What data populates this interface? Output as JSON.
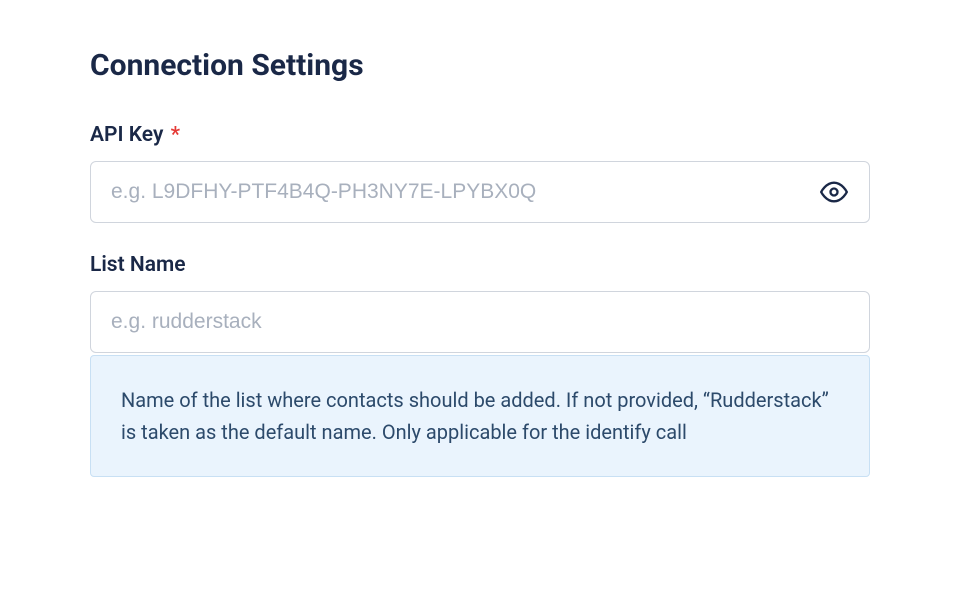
{
  "page": {
    "title": "Connection Settings"
  },
  "fields": {
    "api_key": {
      "label": "API Key",
      "required_marker": "*",
      "placeholder": "e.g. L9DFHY-PTF4B4Q-PH3NY7E-LPYBX0Q",
      "value": ""
    },
    "list_name": {
      "label": "List Name",
      "placeholder": "e.g. rudderstack",
      "value": "",
      "help_text": "Name of the list where contacts should be added. If not provided, “Rudderstack” is taken as the default name. Only applicable for the identify call"
    }
  }
}
